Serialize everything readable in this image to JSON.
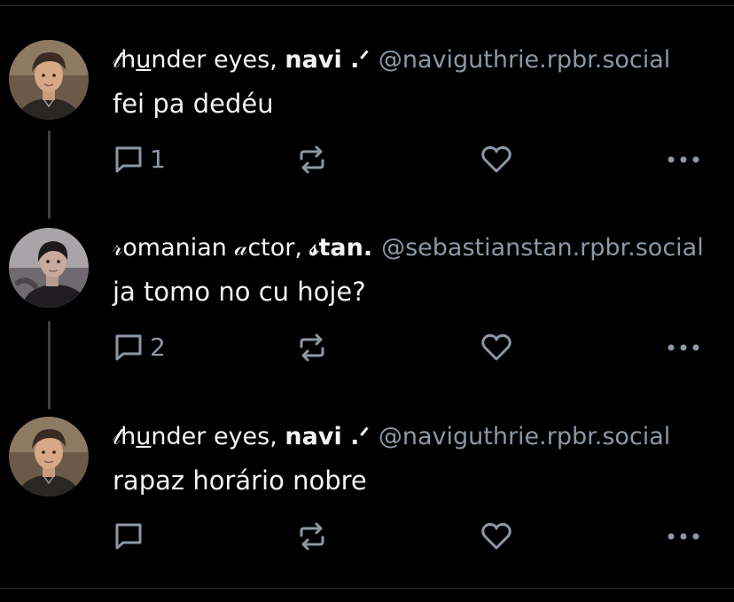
{
  "posts": [
    {
      "display_name_prefix": "𝓉h",
      "display_name_u": "u",
      "display_name_rest": "nder eyes",
      "display_name_sep": ", ",
      "display_name_bold": "navi",
      "display_name_suffix": " .ᐟ",
      "handle": "@naviguthrie.rpbr.social",
      "text": "fei pa dedéu",
      "reply_count": "1",
      "avatar": "avatar-young-man-icon"
    },
    {
      "display_name_prefix": "𝓇omanian ",
      "display_name_u": "𝒶",
      "display_name_rest": "ctor",
      "display_name_sep": ", ",
      "display_name_bold": "𝓈tan.",
      "display_name_suffix": "",
      "handle": "@sebastianstan.rpbr.social",
      "text": "ja tomo no cu hoje?",
      "reply_count": "2",
      "avatar": "avatar-man-dark-icon"
    },
    {
      "display_name_prefix": "𝓉h",
      "display_name_u": "u",
      "display_name_rest": "nder eyes",
      "display_name_sep": ", ",
      "display_name_bold": "navi",
      "display_name_suffix": " .ᐟ",
      "handle": "@naviguthrie.rpbr.social",
      "text": "rapaz horário nobre",
      "reply_count": "",
      "avatar": "avatar-young-man-icon"
    }
  ],
  "colors": {
    "background": "#000000",
    "text": "#f2f3f5",
    "muted": "#8b98a5",
    "thread_line": "#3a4047"
  }
}
